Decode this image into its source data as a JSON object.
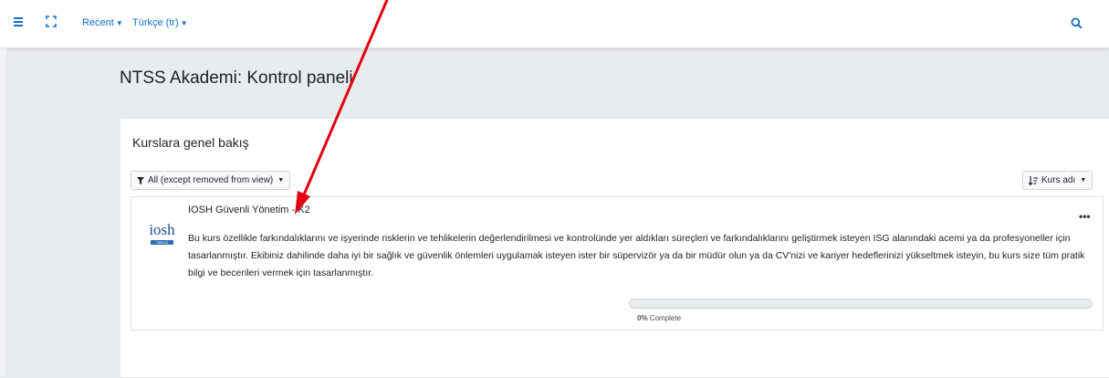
{
  "topbar": {
    "recent_label": "Recent",
    "language_label": "Türkçe (tr)",
    "icons": {
      "menu": "hamburger-icon",
      "fullscreen": "fullscreen-icon",
      "search": "search-icon"
    }
  },
  "page": {
    "title": "NTSS Akademi: Kontrol paneli"
  },
  "overview": {
    "title": "Kurslara genel bakış",
    "filter_label": "All (except removed from view)",
    "sort_label": "Kurs adı",
    "courses": [
      {
        "name": "IOSH Güvenli Yönetim - K2",
        "logo_text": "iosh",
        "logo_badge": "TÜRKÇE",
        "summary": "Bu kurs özellikle farkındalıklarını ve işyerinde risklerin ve tehlikelerin değerlendirilmesi ve kontrolünde yer aldıkları süreçleri ve farkındalıklarını geliştirmek isteyen ISG alanındaki acemi ya da profesyoneller için tasarlanmıştır. Ekibiniz dahilinde daha iyi bir sağlık ve güvenlik önlemleri uygulamak isteyen ister bir süpervizör ya da bir müdür olun ya da CV'nizi ve kariyer hedeflerinizi yükseltmek isteyin, bu kurs size tüm pratik bilgi ve becerileri vermek için tasarlanmıştır.",
        "progress_percent": "0%",
        "progress_suffix": "Complete",
        "progress_value": 0
      }
    ]
  },
  "colors": {
    "accent": "#0f6fc5",
    "annotation_arrow": "#e3000f"
  }
}
